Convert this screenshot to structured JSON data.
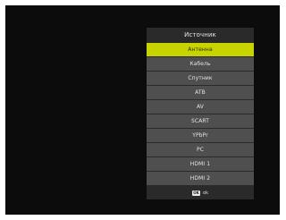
{
  "menu": {
    "title": "Источник",
    "items": [
      {
        "label": "Антенна",
        "selected": true
      },
      {
        "label": "Кабель",
        "selected": false
      },
      {
        "label": "Спутник",
        "selected": false
      },
      {
        "label": "ATB",
        "selected": false
      },
      {
        "label": "AV",
        "selected": false
      },
      {
        "label": "SCART",
        "selected": false
      },
      {
        "label": "YPbPr",
        "selected": false
      },
      {
        "label": "PC",
        "selected": false
      },
      {
        "label": "HDMI 1",
        "selected": false
      },
      {
        "label": "HDMI 2",
        "selected": false
      }
    ],
    "footer": {
      "key_icon": "ok-key-icon",
      "key_label": "OK",
      "hint": "ok"
    }
  },
  "colors": {
    "screen_bg": "#0c0c0c",
    "panel_bg": "#2a2a2a",
    "item_bg": "#4f4f4f",
    "selected_bg": "#c7d400"
  }
}
